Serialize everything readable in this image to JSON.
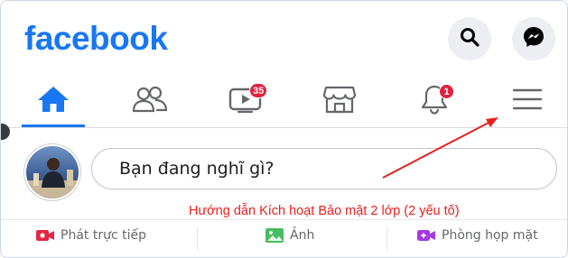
{
  "header": {
    "logo_text": "facebook",
    "brand_color": "#1877f2"
  },
  "nav": {
    "items": [
      {
        "name": "home",
        "icon": "home-icon",
        "active": true
      },
      {
        "name": "friends",
        "icon": "friends-icon"
      },
      {
        "name": "watch",
        "icon": "watch-icon",
        "badge": "35"
      },
      {
        "name": "marketplace",
        "icon": "marketplace-icon"
      },
      {
        "name": "notifications",
        "icon": "bell-icon",
        "badge": "1"
      },
      {
        "name": "menu",
        "icon": "menu-icon"
      }
    ]
  },
  "composer": {
    "placeholder": "Bạn đang nghĩ gì?"
  },
  "annotation": {
    "text": "Hướng dẫn Kích hoạt Bảo mật 2 lớp (2 yếu tố)",
    "color": "#e8201f"
  },
  "actions": [
    {
      "label": "Phát trực tiếp",
      "icon": "live-video-icon",
      "color": "#e42645"
    },
    {
      "label": "Ảnh",
      "icon": "photo-icon",
      "color": "#45bd62"
    },
    {
      "label": "Phòng họp mặt",
      "icon": "rooms-icon",
      "color": "#a33be4"
    }
  ]
}
